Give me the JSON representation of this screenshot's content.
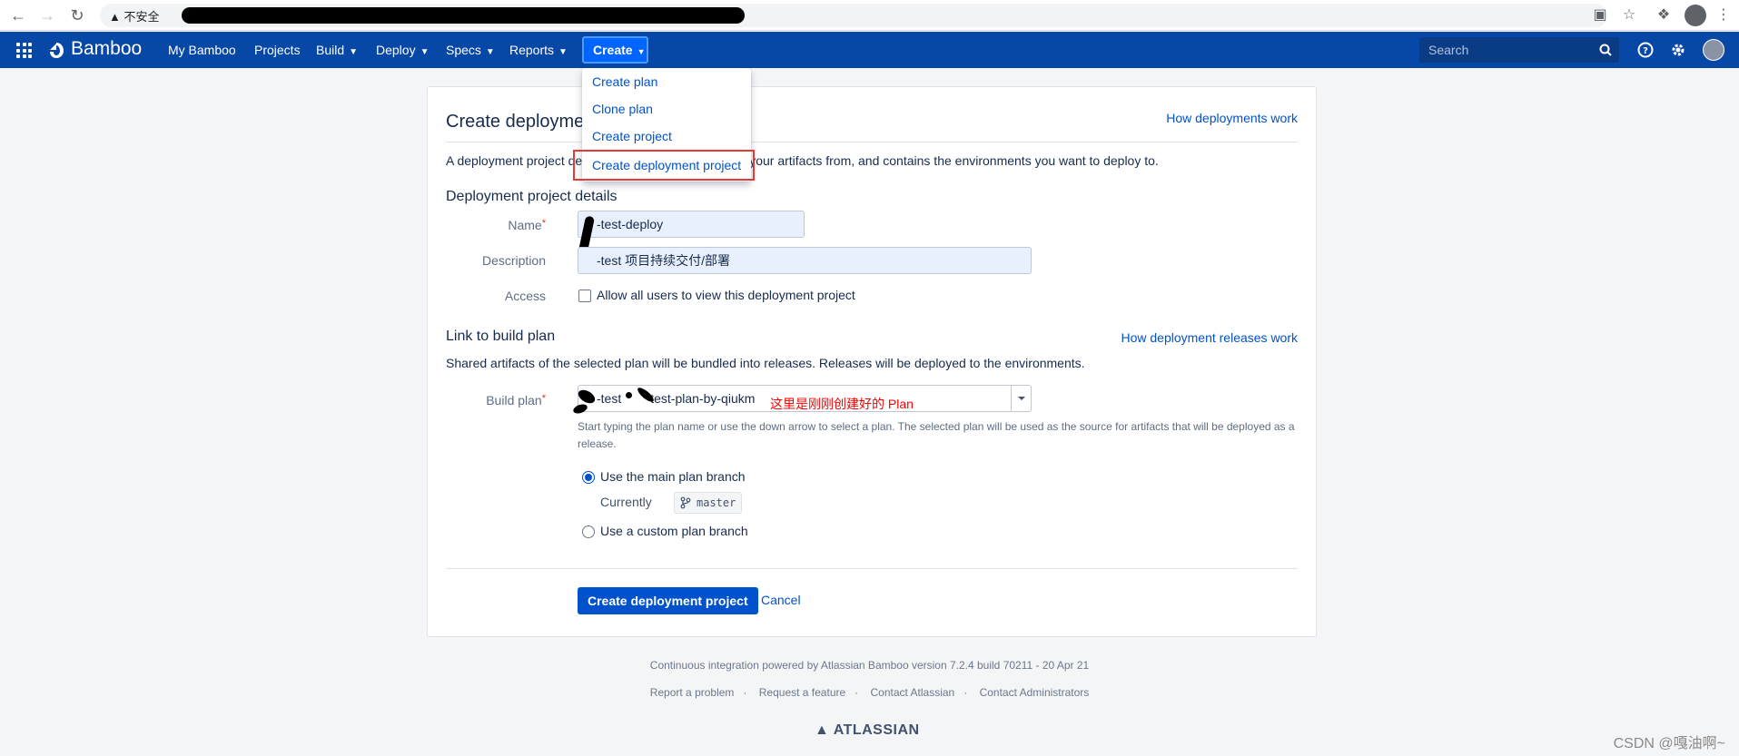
{
  "browser": {
    "security_warning": "不安全",
    "icons": [
      "back-icon",
      "forward-icon",
      "reload-icon",
      "translate-icon",
      "star-icon",
      "extensions-icon",
      "profile-icon",
      "menu-icon"
    ]
  },
  "header": {
    "logo": "Bamboo",
    "nav": [
      "My Bamboo",
      "Projects",
      "Build",
      "Deploy",
      "Specs",
      "Reports"
    ],
    "create_label": "Create",
    "search_placeholder": "Search"
  },
  "create_menu": {
    "items": [
      "Create plan",
      "Clone plan",
      "Create project",
      "Create deployment project"
    ]
  },
  "page": {
    "title": "Create deployme",
    "how_link": "How deployments work",
    "description_start": "A deployment project de",
    "description_end": "your artifacts from, and contains the environments you want to deploy to.",
    "details_heading": "Deployment project details",
    "name_label": "Name",
    "name_value": "-test-deploy",
    "description_label": "Description",
    "description_value": "-test 项目持续交付/部署",
    "access_label": "Access",
    "access_checkbox_label": "Allow all users to view this deployment project",
    "link_heading": "Link to build plan",
    "releases_link": "How deployment releases work",
    "link_desc": "Shared artifacts of the selected plan will be bundled into releases. Releases will be deployed to the environments.",
    "build_plan_label": "Build plan",
    "build_plan_value_a": "-test",
    "build_plan_value_b": "test-plan-by-qiukm",
    "annotation": "这里是刚刚创建好的 Plan",
    "help_line1": "Start typing the plan name or use the down arrow to select a plan. The selected plan will be used as the source for artifacts that will be deployed as a",
    "help_line2": "release.",
    "radio_main": "Use the main plan branch",
    "currently_label": "Currently",
    "branch": "master",
    "radio_custom": "Use a custom plan branch",
    "submit": "Create deployment project",
    "cancel": "Cancel"
  },
  "footer": {
    "powered": "Continuous integration powered by Atlassian Bamboo version 7.2.4 build 70211 - 20 Apr 21",
    "links": [
      "Report a problem",
      "Request a feature",
      "Contact Atlassian",
      "Contact Administrators"
    ],
    "brand": "ATLASSIAN"
  },
  "watermark": "CSDN @嘎油啊~",
  "colors": {
    "header_bg": "#0747a6",
    "primary": "#0052cc",
    "link": "#0052cc",
    "highlight_box": "#e53935",
    "annotation": "#ff0000"
  }
}
